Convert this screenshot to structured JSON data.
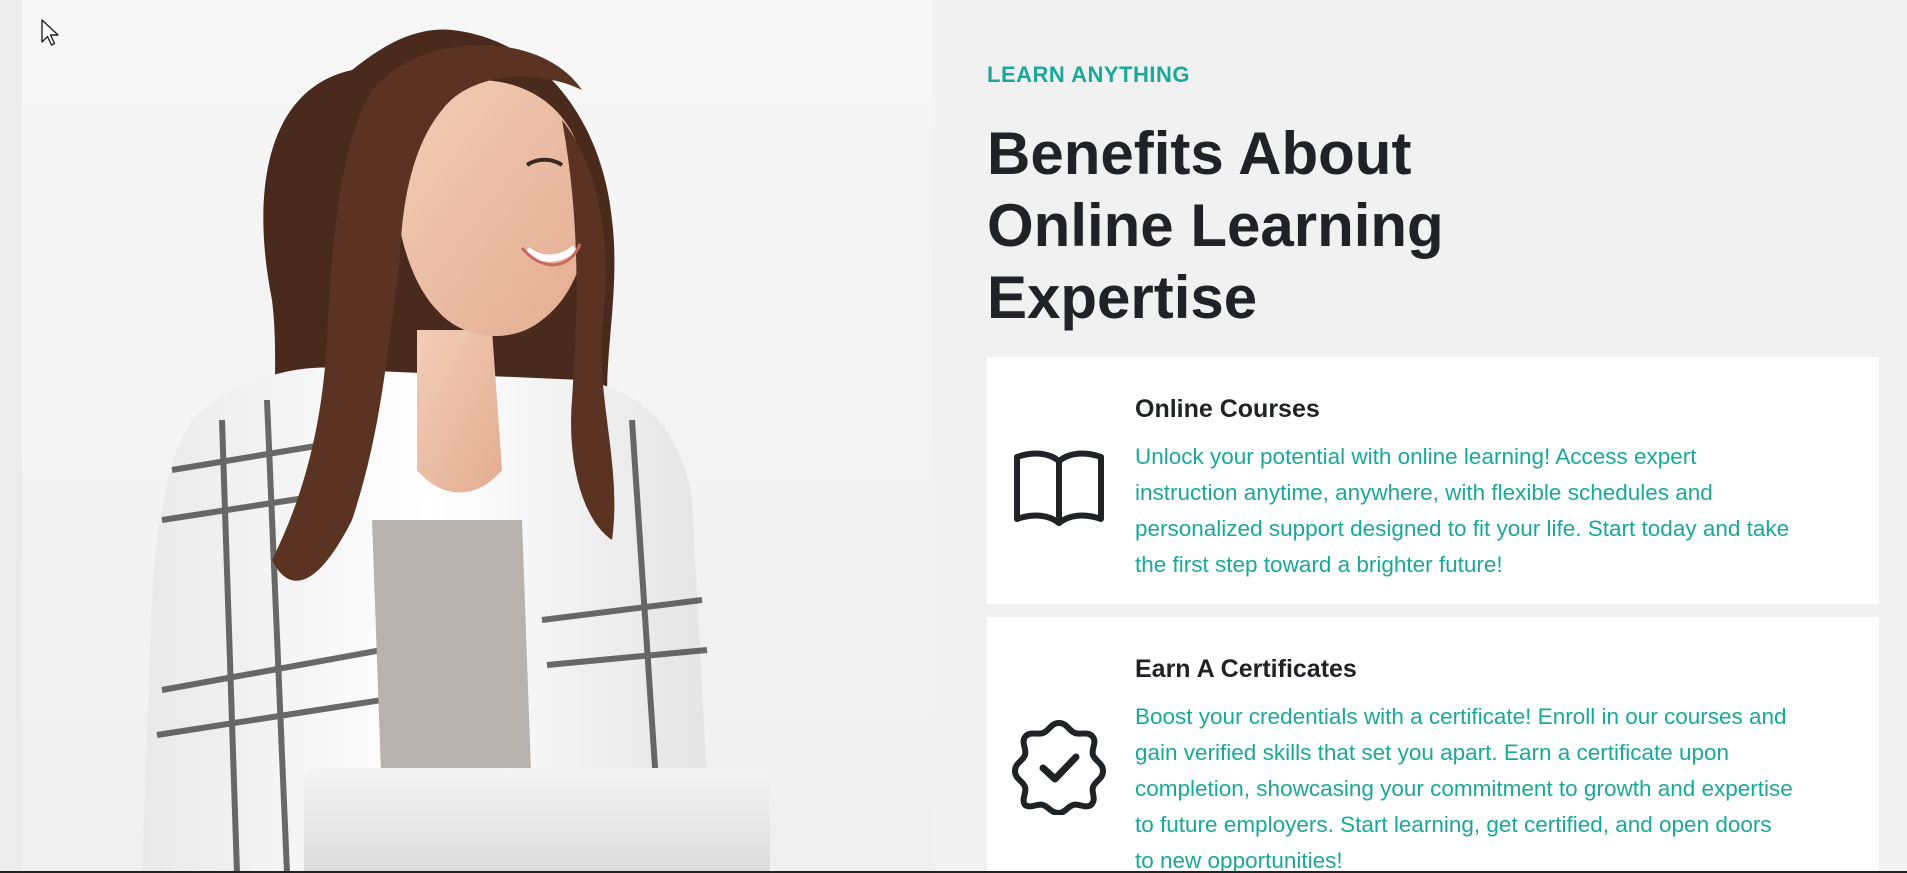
{
  "section": {
    "eyebrow": "LEARN ANYTHING",
    "heading": "Benefits About Online Learning Expertise"
  },
  "cards": [
    {
      "title": "Online Courses",
      "description": "Unlock your potential with online learning! Access expert instruction anytime, anywhere, with flexible schedules and personalized support designed to fit your life. Start today and take the first step toward a brighter future!",
      "icon": "open-book-icon"
    },
    {
      "title": "Earn A Certificates",
      "description": "Boost your credentials with a certificate! Enroll in our courses and gain verified skills that set you apart. Earn a certificate upon completion, showcasing your commitment to growth and expertise to future employers. Start learning, get certified, and open doors to new opportunities!",
      "icon": "certificate-badge-check-icon"
    }
  ],
  "hero": {
    "image": "smiling-woman-with-laptop-photo"
  },
  "colors": {
    "accent": "#1aa89a",
    "heading": "#202226",
    "card_background": "#ffffff",
    "page_background": "#f1f1f1"
  }
}
